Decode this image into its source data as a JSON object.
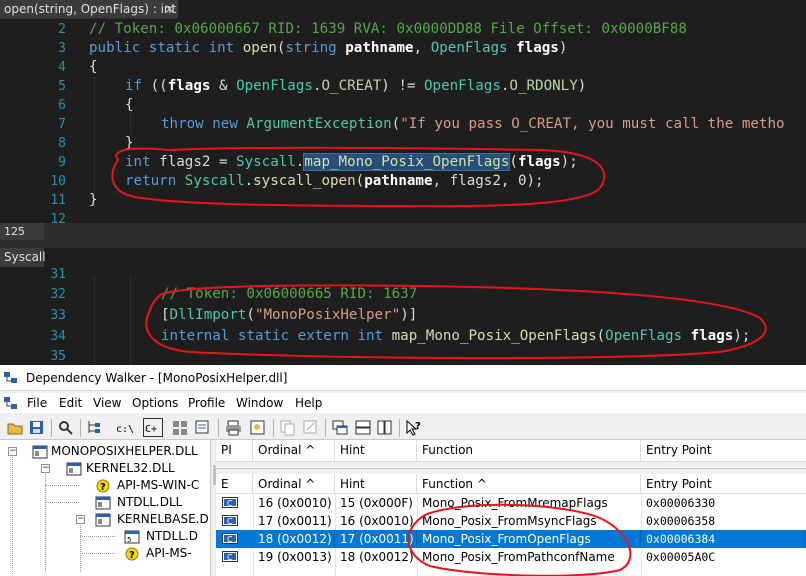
{
  "editor_top": {
    "tab_title": "open(string, OpenFlags) : int",
    "close_glyph": "×",
    "zoom": "125 %",
    "line_numbers": [
      "2",
      "3",
      "4",
      "5",
      "6",
      "7",
      "8",
      "9",
      "10",
      "11",
      "12"
    ],
    "lines": {
      "l2": "// Token: 0x06000667 RID: 1639 RVA: 0x0000DD88 File Offset: 0x0000BF88",
      "l3_kw": "public static int ",
      "l3_fn": "open",
      "l3_p1": "(",
      "l3_kw2": "string ",
      "l3_b1": "pathname",
      "l3_p2": ", ",
      "l3_ty": "OpenFlags ",
      "l3_b2": "flags",
      "l3_p3": ")",
      "l4": "{",
      "l5_kw": "if ",
      "l5_a": "((",
      "l5_b": "flags",
      "l5_c": " & ",
      "l5_ty": "OpenFlags",
      "l5_d": ".",
      "l5_e1": "O_CREAT",
      "l5_f": ") != ",
      "l5_ty2": "OpenFlags",
      "l5_g": ".",
      "l5_e2": "O_RDONLY",
      "l5_h": ")",
      "l6": "{",
      "l7_kw": "throw new ",
      "l7_ty": "ArgumentException",
      "l7_p": "(",
      "l7_st": "\"If you pass O_CREAT, you must call the metho",
      "l8": "}",
      "l9_kw": "int ",
      "l9_a": "flags2 = ",
      "l9_ty": "Syscall",
      "l9_d": ".",
      "l9_fn": "map_Mono_Posix_OpenFlags",
      "l9_p": "(",
      "l9_b": "flags",
      "l9_e": ");",
      "l10_kw": "return ",
      "l10_ty": "Syscall",
      "l10_d": ".",
      "l10_fn": "syscall_open",
      "l10_p": "(",
      "l10_b": "pathname",
      "l10_e": ", flags2, 0);",
      "l11": "}"
    }
  },
  "editor_bottom": {
    "tab_title": "Syscall",
    "line_numbers": [
      "31",
      "32",
      "33",
      "34",
      "35"
    ],
    "lines": {
      "l32": "// Token: 0x06000665 RID: 1637",
      "l33_a": "[",
      "l33_ty": "DllImport",
      "l33_b": "(",
      "l33_st": "\"MonoPosixHelper\"",
      "l33_c": ")]",
      "l34_kw": "internal static extern int ",
      "l34_fn": "map_Mono_Posix_OpenFlags",
      "l34_a": "(",
      "l34_ty": "OpenFlags ",
      "l34_b": "flags",
      "l34_c": ");"
    }
  },
  "depwalker": {
    "title": "Dependency Walker - [MonoPosixHelper.dll]",
    "menu": [
      "File",
      "Edit",
      "View",
      "Options",
      "Profile",
      "Window",
      "Help"
    ],
    "tree": [
      {
        "label": "MONOPOSIXHELPER.DLL",
        "icon": "dll-module-icon"
      },
      {
        "label": "KERNEL32.DLL",
        "icon": "dll-module-icon"
      },
      {
        "label": "API-MS-WIN-C",
        "icon": "missing-module-icon"
      },
      {
        "label": "NTDLL.DLL",
        "icon": "dll-module-icon"
      },
      {
        "label": "KERNELBASE.D",
        "icon": "dll-module-icon"
      },
      {
        "label": "NTDLL.D",
        "icon": "dll-module-icon"
      },
      {
        "label": "API-MS-",
        "icon": "missing-module-icon"
      }
    ],
    "import_headers": [
      "PI",
      "Ordinal ^",
      "Hint",
      "Function",
      "Entry Point"
    ],
    "export_headers": [
      "E",
      "Ordinal ^",
      "Hint",
      "Function ^",
      "Entry Point"
    ],
    "exports": [
      {
        "ordinal": "16 (0x0010)",
        "hint": "15 (0x000F)",
        "function": "Mono_Posix_FromMremapFlags",
        "entry": "0x00006330",
        "selected": false
      },
      {
        "ordinal": "17 (0x0011)",
        "hint": "16 (0x0010)",
        "function": "Mono_Posix_FromMsyncFlags",
        "entry": "0x00006358",
        "selected": false
      },
      {
        "ordinal": "18 (0x0012)",
        "hint": "17 (0x0011)",
        "function": "Mono_Posix_FromOpenFlags",
        "entry": "0x00006384",
        "selected": true
      },
      {
        "ordinal": "19 (0x0013)",
        "hint": "18 (0x0012)",
        "function": "Mono_Posix_FromPathconfName",
        "entry": "0x00005A0C",
        "selected": false
      }
    ],
    "c_badge": "C",
    "accent_selected": "#0078d7"
  },
  "annotation_color": "#e8141c"
}
